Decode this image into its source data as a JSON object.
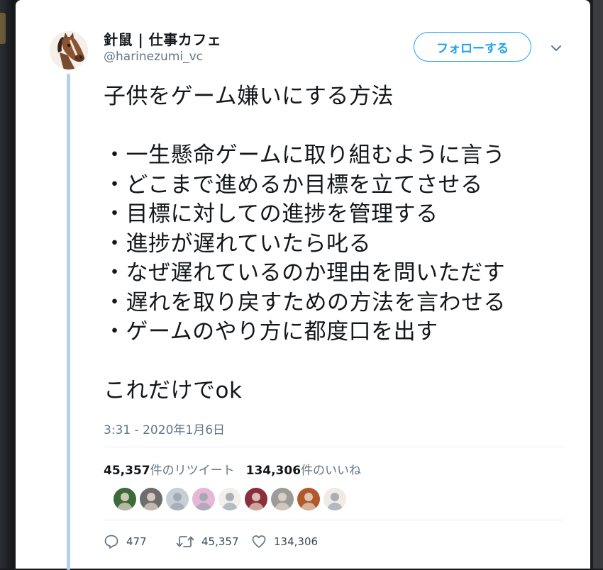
{
  "author": {
    "display_name": "針鼠 | 仕事カフェ",
    "handle": "@harinezumi_vc",
    "avatar_icon": "horse-avatar-icon"
  },
  "follow_button": {
    "label": "フォローする"
  },
  "menu": {
    "icon": "chevron-down-icon"
  },
  "tweet": {
    "lines": [
      "子供をゲーム嫌いにする方法",
      "",
      "・一生懸命ゲームに取り組むように言う",
      "・どこまで進めるか目標を立てさせる",
      "・目標に対しての進捗を管理する",
      "・進捗が遅れていたら叱る",
      "・なぜ遅れているのか理由を問いただす",
      "・遅れを取り戻すための方法を言わせる",
      "・ゲームのやり方に都度口を出す",
      "",
      "これだけでok"
    ]
  },
  "timestamp": "3:31 - 2020年1月6日",
  "stats": {
    "retweets_count": "45,357",
    "retweets_label": "件のリツイート",
    "likes_count": "134,306",
    "likes_label": "件のいいね"
  },
  "likers": [
    {
      "name": "liker-avatar-1",
      "color": "#3c6b3a"
    },
    {
      "name": "liker-avatar-2",
      "color": "#6d6d6d"
    },
    {
      "name": "liker-avatar-3",
      "color": "#c8ced6"
    },
    {
      "name": "liker-avatar-4",
      "color": "#e7b8d6"
    },
    {
      "name": "liker-avatar-5",
      "color": "#f3f0ea"
    },
    {
      "name": "liker-avatar-6",
      "color": "#8a2f3b"
    },
    {
      "name": "liker-avatar-7",
      "color": "#9b9b9b"
    },
    {
      "name": "liker-avatar-8",
      "color": "#b0592a"
    },
    {
      "name": "liker-avatar-9",
      "color": "#f1ebe4"
    }
  ],
  "actions": {
    "reply_count": "477",
    "retweet_count": "45,357",
    "like_count": "134,306"
  },
  "colors": {
    "accent": "#1da1f2",
    "muted_text": "#657786",
    "thread_line": "#b4d0ee"
  }
}
